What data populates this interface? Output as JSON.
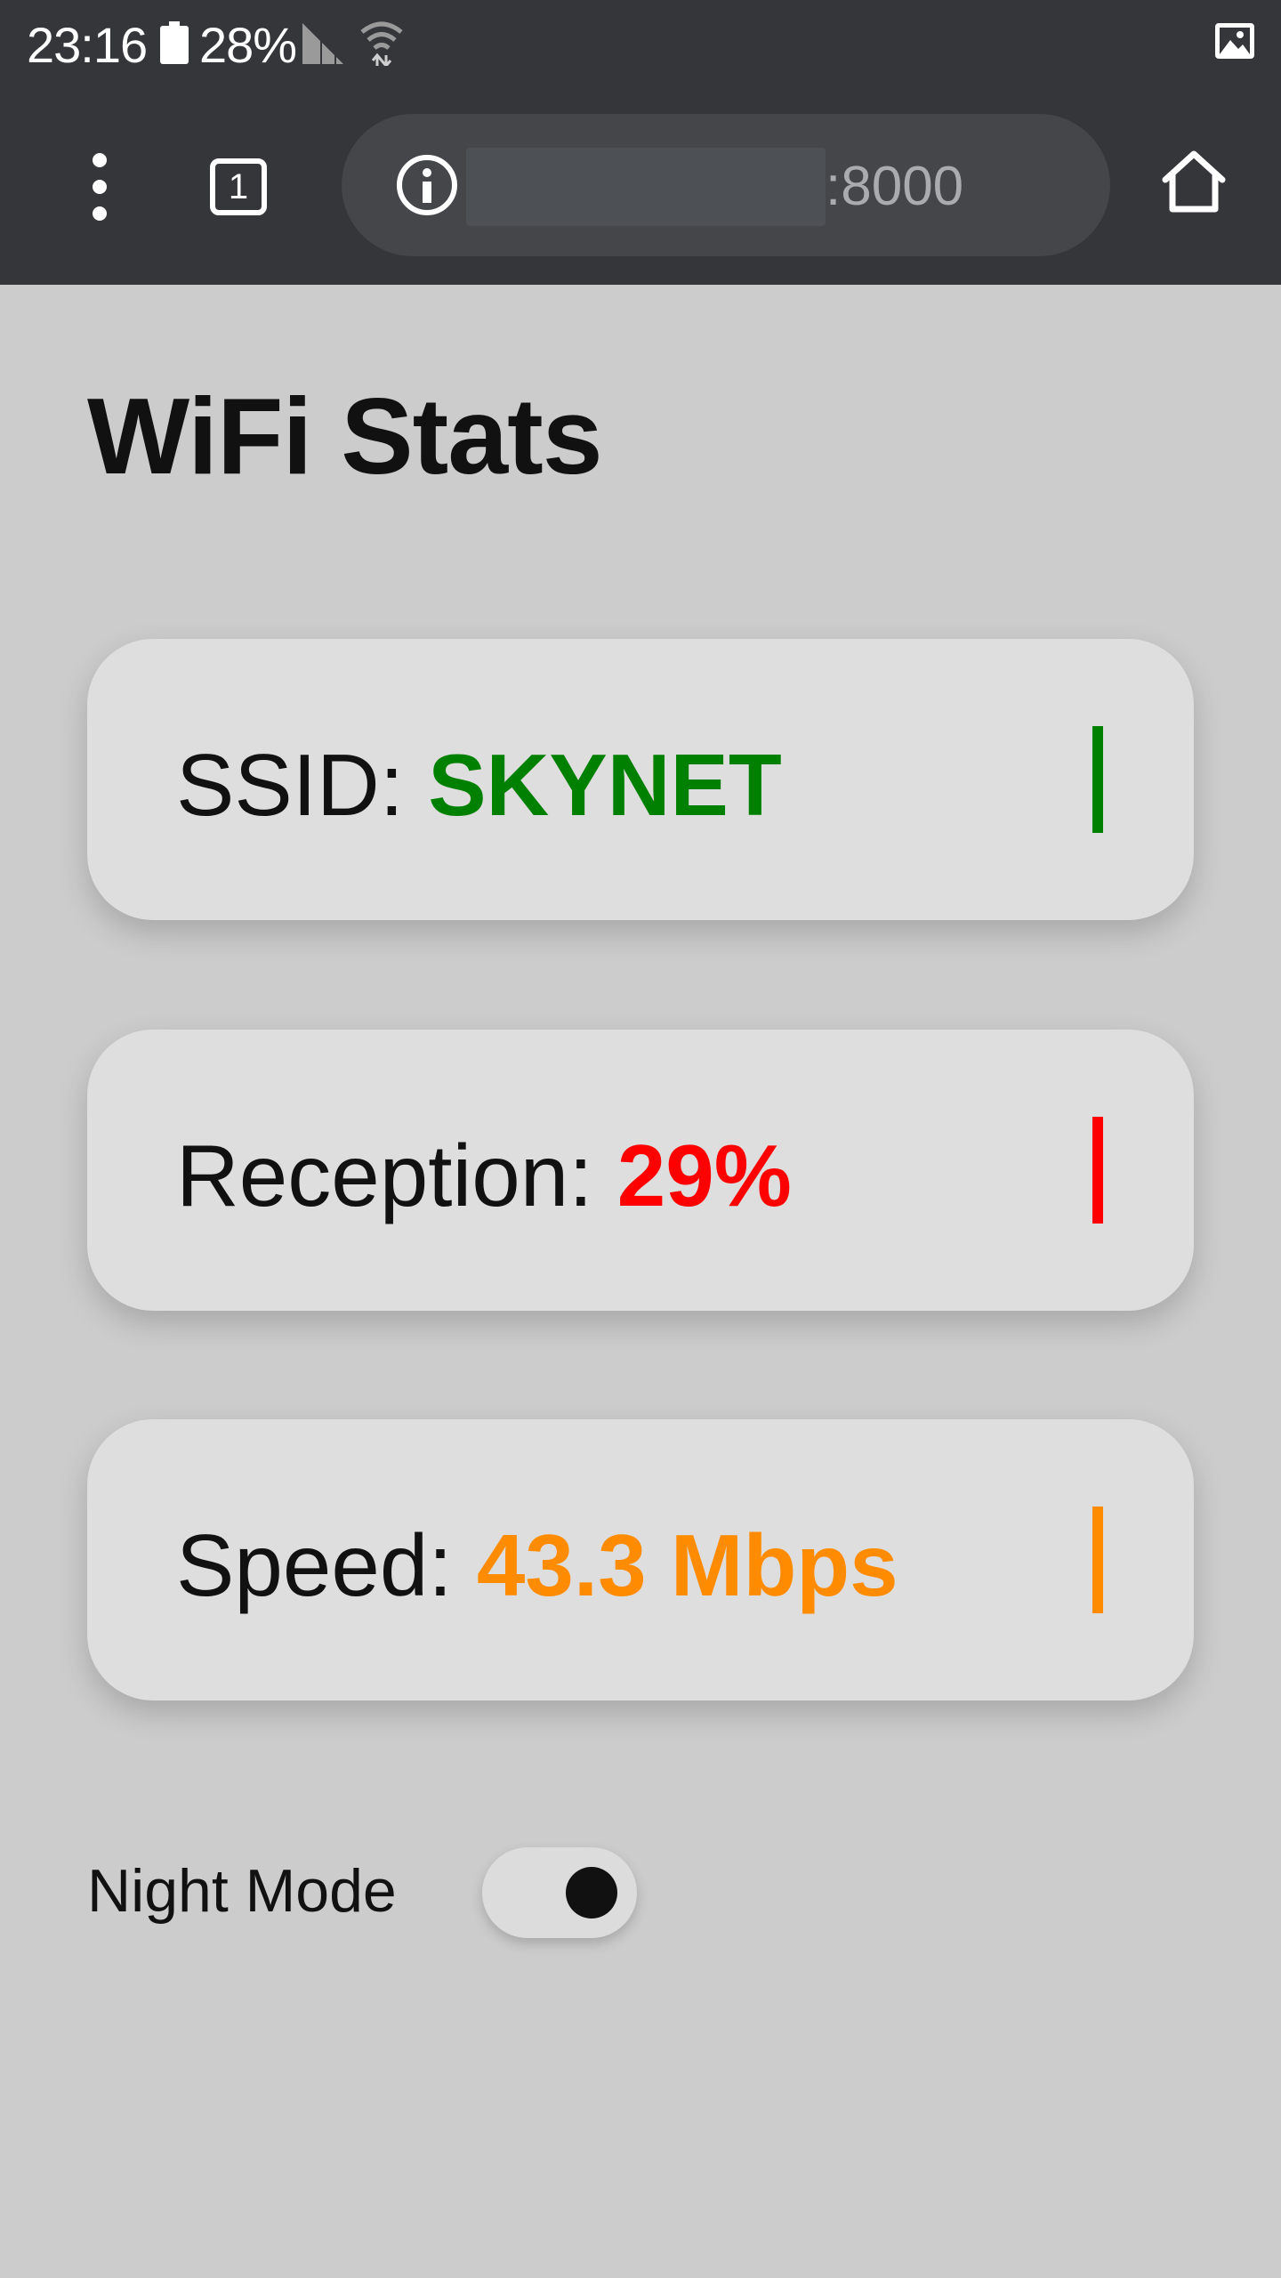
{
  "status_bar": {
    "time": "23:16",
    "battery_percent": "28%",
    "battery_icon": "battery-icon",
    "signal_icon": "cell-signal-icon",
    "wifi_icon": "wifi-icon",
    "notification_icon": "image-icon"
  },
  "browser": {
    "menu_icon": "more-vert-icon",
    "tab_count": "1",
    "info_icon": "info-icon",
    "url_port": ":8000",
    "home_icon": "home-icon"
  },
  "page": {
    "title": "WiFi Stats",
    "cards": [
      {
        "label": "SSID: ",
        "value": "SKYNET",
        "color": "#008000"
      },
      {
        "label": "Reception: ",
        "value": "29%",
        "color": "#ff0000"
      },
      {
        "label": "Speed: ",
        "value": "43.3 Mbps",
        "color": "#ff8c00"
      }
    ],
    "night_mode": {
      "label": "Night Mode",
      "enabled": true
    }
  }
}
